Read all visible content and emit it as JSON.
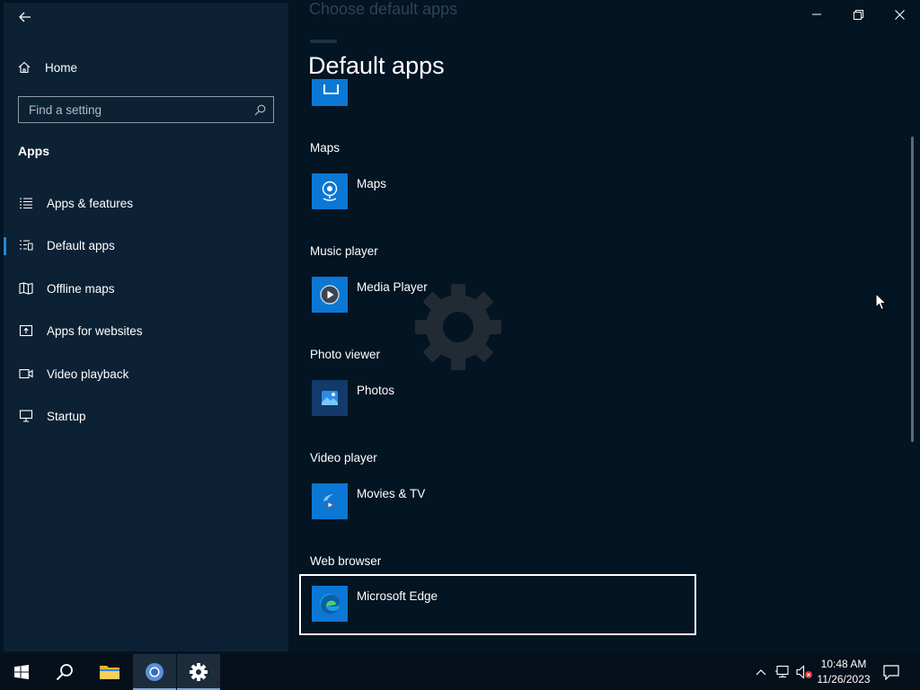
{
  "window": {
    "ghost_title": "Choose default apps",
    "title": "Default apps"
  },
  "sidebar": {
    "home_label": "Home",
    "search_placeholder": "Find a setting",
    "section_title": "Apps",
    "items": [
      {
        "label": "Apps & features",
        "icon": "list-icon"
      },
      {
        "label": "Default apps",
        "icon": "default-apps-icon",
        "active": true
      },
      {
        "label": "Offline maps",
        "icon": "map-icon"
      },
      {
        "label": "Apps for websites",
        "icon": "open-website-icon"
      },
      {
        "label": "Video playback",
        "icon": "video-icon"
      },
      {
        "label": "Startup",
        "icon": "startup-icon"
      }
    ]
  },
  "defaults": [
    {
      "category": "Maps",
      "app": "Maps",
      "icon": "maps-app-icon"
    },
    {
      "category": "Music player",
      "app": "Media Player",
      "icon": "media-player-icon"
    },
    {
      "category": "Photo viewer",
      "app": "Photos",
      "icon": "photos-icon"
    },
    {
      "category": "Video player",
      "app": "Movies & TV",
      "icon": "movies-tv-icon"
    },
    {
      "category": "Web browser",
      "app": "Microsoft Edge",
      "icon": "edge-icon",
      "focused": true
    }
  ],
  "taskbar": {
    "time": "10:48 AM",
    "date": "11/26/2023"
  },
  "colors": {
    "accent": "#0a78d4",
    "window_bg": "#031423",
    "sidebar_bg": "#0c2134",
    "taskbar_bg": "#06101a"
  }
}
